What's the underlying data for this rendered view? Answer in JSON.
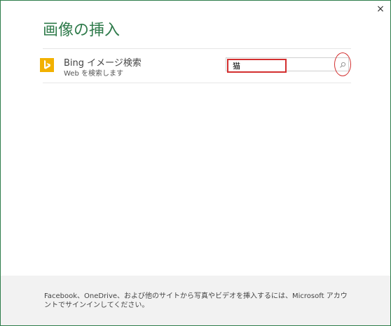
{
  "dialog": {
    "title": "画像の挿入",
    "close_label": "×"
  },
  "provider": {
    "name": "Bing イメージ検索",
    "subtitle": "Web を検索します",
    "icon": "bing-logo-icon",
    "brand_color": "#f2b100"
  },
  "search": {
    "value": "猫",
    "placeholder": "",
    "button_icon": "magnifier-icon"
  },
  "footer": {
    "message": "Facebook、OneDrive、および他のサイトから写真やビデオを挿入するには、Microsoft アカウントでサインインしてください。"
  },
  "colors": {
    "accent": "#2f7b4b",
    "highlight": "#d32f2f"
  }
}
